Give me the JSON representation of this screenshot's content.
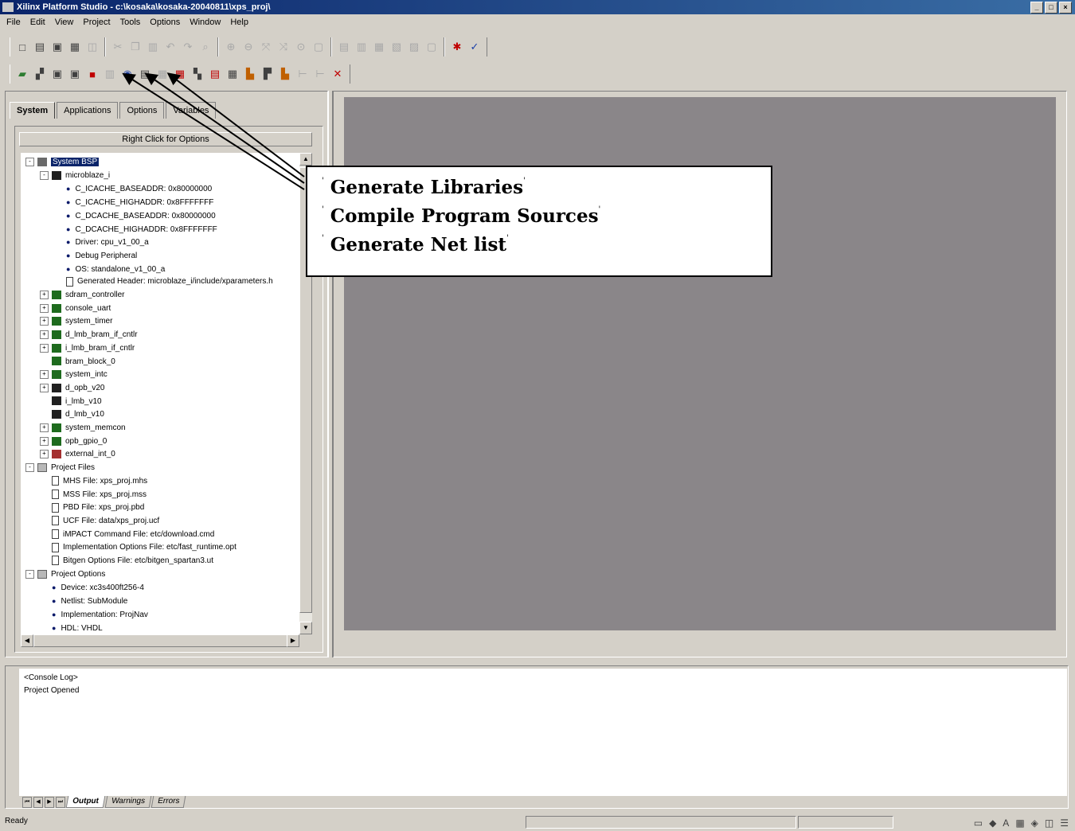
{
  "window": {
    "title": "Xilinx Platform Studio - c:\\kosaka\\kosaka-20040811\\xps_proj\\",
    "buttons": [
      "_",
      "□",
      "×"
    ]
  },
  "menu": [
    "File",
    "Edit",
    "View",
    "Project",
    "Tools",
    "Options",
    "Window",
    "Help"
  ],
  "toolbar1": {
    "groups": [
      [
        "new-icon",
        "open-icon",
        "save-icon",
        "print-icon",
        "preview-icon"
      ],
      [
        "cut-icon",
        "copy-icon",
        "paste-icon",
        "undo-icon",
        "redo-icon",
        "find-icon"
      ],
      [
        "zoom-in-icon",
        "zoom-out-icon",
        "fit-icon",
        "zoom-area-icon",
        "zoom-select-icon",
        "zoom-page-icon"
      ],
      [
        "layout-1-icon",
        "layout-2-icon",
        "layout-3-icon",
        "layout-4-icon",
        "layout-5-icon",
        "layout-6-icon"
      ],
      [
        "tool-a-icon",
        "tool-b-icon"
      ]
    ]
  },
  "toolbar2": {
    "icons": [
      "open-project-icon",
      "options-icon",
      "window-1-icon",
      "window-2-icon",
      "stop-icon",
      "generate-libraries-icon",
      "compile-program-sources-icon",
      "generate-netlist-icon",
      "bitstream-icon",
      "tool-c-icon",
      "tool-d-icon",
      "tool-e-icon",
      "tool-f-icon",
      "tool-g-icon",
      "tool-h-icon",
      "tool-i-icon",
      "tool-j-icon",
      "tool-k-icon",
      "clear-icon"
    ]
  },
  "tabs": [
    "System",
    "Applications",
    "Options",
    "Variables"
  ],
  "right_click": "Right Click for Options",
  "tree": [
    {
      "depth": 0,
      "exp": "-",
      "icon": "gray",
      "label": "System BSP",
      "selected": true
    },
    {
      "depth": 1,
      "exp": "-",
      "icon": "dark",
      "label": "microblaze_i"
    },
    {
      "depth": 2,
      "bullet": true,
      "label": "C_ICACHE_BASEADDR: 0x80000000"
    },
    {
      "depth": 2,
      "bullet": true,
      "label": "C_ICACHE_HIGHADDR: 0x8FFFFFFF"
    },
    {
      "depth": 2,
      "bullet": true,
      "label": "C_DCACHE_BASEADDR: 0x80000000"
    },
    {
      "depth": 2,
      "bullet": true,
      "label": "C_DCACHE_HIGHADDR: 0x8FFFFFFF"
    },
    {
      "depth": 2,
      "bullet": true,
      "label": "Driver: cpu_v1_00_a"
    },
    {
      "depth": 2,
      "bullet": true,
      "label": "Debug Peripheral"
    },
    {
      "depth": 2,
      "bullet": true,
      "label": "OS: standalone_v1_00_a"
    },
    {
      "depth": 2,
      "icon": "doc",
      "label": "Generated Header: microblaze_i/include/xparameters.h"
    },
    {
      "depth": 1,
      "exp": "+",
      "icon": "green",
      "label": "sdram_controller"
    },
    {
      "depth": 1,
      "exp": "+",
      "icon": "green",
      "label": "console_uart"
    },
    {
      "depth": 1,
      "exp": "+",
      "icon": "green",
      "label": "system_timer"
    },
    {
      "depth": 1,
      "exp": "+",
      "icon": "green",
      "label": "d_lmb_bram_if_cntlr"
    },
    {
      "depth": 1,
      "exp": "+",
      "icon": "green",
      "label": "i_lmb_bram_if_cntlr"
    },
    {
      "depth": 1,
      "icon": "green",
      "label": "bram_block_0"
    },
    {
      "depth": 1,
      "exp": "+",
      "icon": "green",
      "label": "system_intc"
    },
    {
      "depth": 1,
      "exp": "+",
      "icon": "dark",
      "label": "d_opb_v20"
    },
    {
      "depth": 1,
      "icon": "dark",
      "label": "i_lmb_v10"
    },
    {
      "depth": 1,
      "icon": "dark",
      "label": "d_lmb_v10"
    },
    {
      "depth": 1,
      "exp": "+",
      "icon": "green",
      "label": "system_memcon"
    },
    {
      "depth": 1,
      "exp": "+",
      "icon": "green",
      "label": "opb_gpio_0"
    },
    {
      "depth": 1,
      "exp": "+",
      "icon": "red",
      "label": "external_int_0"
    },
    {
      "depth": 0,
      "exp": "-",
      "icon": "folder",
      "label": "Project Files"
    },
    {
      "depth": 1,
      "icon": "doc",
      "label": "MHS File: xps_proj.mhs"
    },
    {
      "depth": 1,
      "icon": "doc",
      "label": "MSS File: xps_proj.mss"
    },
    {
      "depth": 1,
      "icon": "doc",
      "label": "PBD File: xps_proj.pbd"
    },
    {
      "depth": 1,
      "icon": "doc",
      "label": "UCF File: data/xps_proj.ucf"
    },
    {
      "depth": 1,
      "icon": "doc",
      "label": "iMPACT Command File: etc/download.cmd"
    },
    {
      "depth": 1,
      "icon": "doc",
      "label": "Implementation Options File: etc/fast_runtime.opt"
    },
    {
      "depth": 1,
      "icon": "doc",
      "label": "Bitgen Options File: etc/bitgen_spartan3.ut"
    },
    {
      "depth": 0,
      "exp": "-",
      "icon": "folder",
      "label": "Project Options"
    },
    {
      "depth": 1,
      "bullet": true,
      "label": "Device: xc3s400ft256-4"
    },
    {
      "depth": 1,
      "bullet": true,
      "label": "Netlist: SubModule"
    },
    {
      "depth": 1,
      "bullet": true,
      "label": "Implementation: ProjNav"
    },
    {
      "depth": 1,
      "bullet": true,
      "label": "HDL: VHDL"
    }
  ],
  "callout": {
    "lines": [
      "Generate Libraries",
      "Compile Program Sources",
      "Generate Net list"
    ],
    "tick": "'"
  },
  "console": {
    "lines": [
      "<Console Log>",
      "Project Opened"
    ]
  },
  "console_tabs": [
    "Output",
    "Warnings",
    "Errors"
  ],
  "status": "Ready"
}
